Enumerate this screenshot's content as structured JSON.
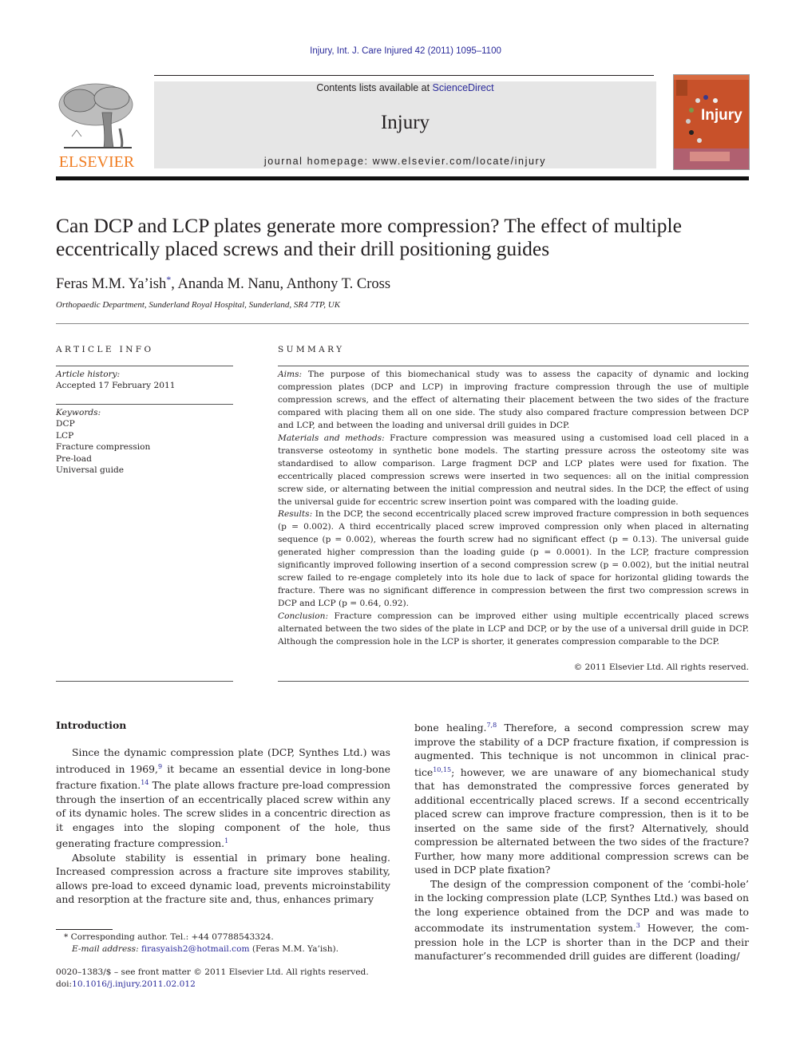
{
  "header": {
    "journal_ref": "Injury, Int. J. Care Injured 42 (2011) 1095–1100",
    "contents_prefix": "Contents lists available at ",
    "contents_link": "ScienceDirect",
    "journal_name": "Injury",
    "homepage": "journal homepage: www.elsevier.com/locate/injury",
    "publisher_logo_text": "ELSEVIER",
    "cover_title": "Injury"
  },
  "colors": {
    "link": "#2a2a9a",
    "elsevier_orange": "#f07c20",
    "cover_orange": "#c8512a",
    "banner_gray": "#e6e6e6"
  },
  "article": {
    "title": "Can DCP and LCP plates generate more compression? The effect of multiple eccentrically placed screws and their drill positioning guides",
    "authors": [
      {
        "name": "Feras M.M. Ya’ish",
        "mark": "*"
      },
      {
        "name": "Ananda M. Nanu",
        "mark": ""
      },
      {
        "name": "Anthony T. Cross",
        "mark": ""
      }
    ],
    "author_sep": ", ",
    "affiliation": "Orthopaedic Department, Sunderland Royal Hospital, Sunderland, SR4 7TP, UK"
  },
  "article_info": {
    "heading": "ARTICLE INFO",
    "history_label": "Article history:",
    "history_value": "Accepted 17 February 2011",
    "keywords_label": "Keywords:",
    "keywords": [
      "DCP",
      "LCP",
      "Fracture compression",
      "Pre-load",
      "Universal guide"
    ]
  },
  "summary": {
    "heading": "SUMMARY",
    "sections": [
      {
        "label": "Aims:",
        "text": " The purpose of this biomechanical study was to assess the capacity of dynamic and locking compression plates (DCP and LCP) in improving fracture compression through the use of multiple compression screws, and the effect of alternating their placement between the two sides of the fracture compared with placing them all on one side. The study also compared fracture compression between DCP and LCP, and between the loading and universal drill guides in DCP."
      },
      {
        "label": "Materials and methods:",
        "text": " Fracture compression was measured using a customised load cell placed in a transverse osteotomy in synthetic bone models. The starting pressure across the osteotomy site was standardised to allow comparison. Large fragment DCP and LCP plates were used for fixation. The eccentrically placed compression screws were inserted in two sequences: all on the initial compression screw side, or alternating between the initial compression and neutral sides. In the DCP, the effect of using the universal guide for eccentric screw insertion point was compared with the loading guide."
      },
      {
        "label": "Results:",
        "text": " In the DCP, the second eccentrically placed screw improved fracture compression in both sequences (p = 0.002). A third eccentrically placed screw improved compression only when placed in alternating sequence (p = 0.002), whereas the fourth screw had no significant effect (p = 0.13). The universal guide generated higher compression than the loading guide (p = 0.0001). In the LCP, fracture compression significantly improved following insertion of a second compression screw (p = 0.002), but the initial neutral screw failed to re-engage completely into its hole due to lack of space for horizontal gliding towards the fracture. There was no significant difference in compression between the first two compression screws in DCP and LCP (p = 0.64, 0.92)."
      },
      {
        "label": "Conclusion:",
        "text": " Fracture compression can be improved either using multiple eccentrically placed screws alternated between the two sides of the plate in LCP and DCP, or by the use of a universal drill guide in DCP. Although the compression hole in the LCP is shorter, it generates compression comparable to the DCP."
      }
    ],
    "copyright": "© 2011 Elsevier Ltd. All rights reserved."
  },
  "body": {
    "intro_heading": "Introduction",
    "left_paragraphs": [
      {
        "parts": [
          {
            "t": "Since the dynamic compression plate (DCP, Synthes Ltd.) was introduced in 1969,"
          },
          {
            "ref": "9"
          },
          {
            "t": " it became an essential device in long-bone fracture fixation."
          },
          {
            "ref": "14"
          },
          {
            "t": " The plate allows fracture pre-load compression through the insertion of an eccentrically placed screw within any of its dynamic holes. The screw slides in a concentric direction as it engages into the sloping component of the hole, thus generating fracture compression."
          },
          {
            "ref": "1"
          }
        ]
      },
      {
        "parts": [
          {
            "t": "Absolute stability is essential in primary bone healing. Increased compression across a fracture site improves stability, allows pre-load to exceed dynamic load, prevents microinstability and resorption at the fracture site and, thus, enhances primary"
          }
        ]
      }
    ],
    "right_paragraphs": [
      {
        "noindent": true,
        "parts": [
          {
            "t": "bone healing."
          },
          {
            "ref": "7,8"
          },
          {
            "t": " Therefore, a second compression screw may improve the stability of a DCP fracture fixation, if compression is augmented. This technique is not uncommon in clinical prac­tice"
          },
          {
            "ref": "10,15"
          },
          {
            "t": "; however, we are unaware of any biomechanical study that has demonstrated the compressive forces generated by additional eccentrically placed screws. If a second eccentrically placed screw can improve fracture compression, then is it to be inserted on the same side of the first? Alternatively, should compression be alternated between the two sides of the fracture? Further, how many more additional compression screws can be used in DCP plate fixation?"
          }
        ]
      },
      {
        "parts": [
          {
            "t": "The design of the compression component of the ‘combi-hole’ in the locking compression plate (LCP, Synthes Ltd.) was based on the long experience obtained from the DCP and was made to accommodate its instrumentation system."
          },
          {
            "ref": "3"
          },
          {
            "t": " However, the com­pression hole in the LCP is shorter than in the DCP and their manufacturer’s recommended drill guides are different (loading/"
          }
        ]
      }
    ]
  },
  "footnotes": {
    "corresponding": "* Corresponding author. Tel.: +44 07788543324.",
    "email_label": "E-mail address:",
    "email": "firasyaish2@hotmail.com",
    "email_suffix": " (Feras M.M. Ya’ish).",
    "front_matter": "0020–1383/$ – see front matter © 2011 Elsevier Ltd. All rights reserved.",
    "doi_prefix": "doi:",
    "doi": "10.1016/j.injury.2011.02.012"
  }
}
